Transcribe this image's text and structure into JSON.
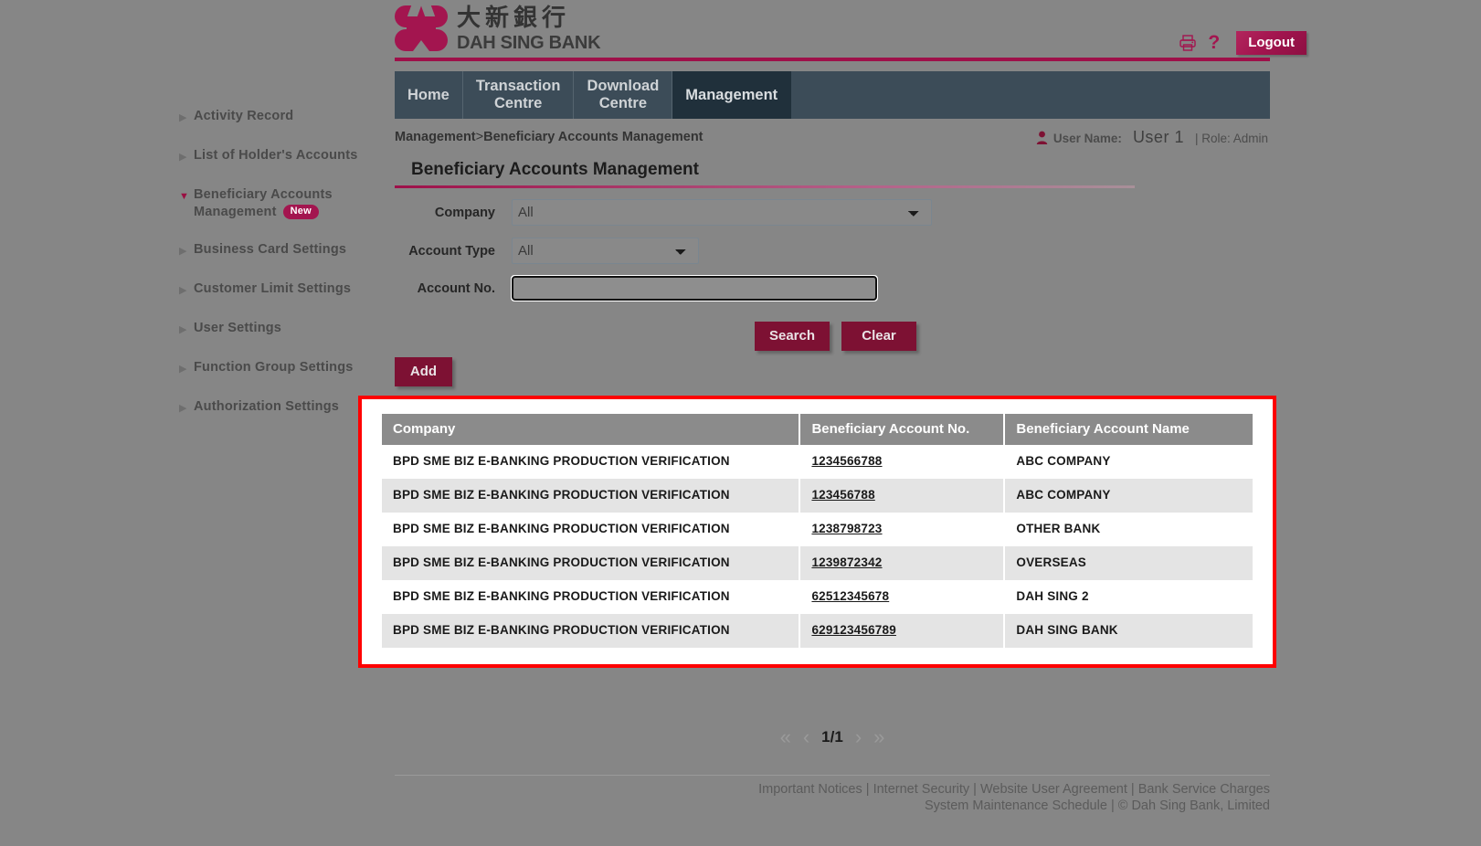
{
  "brand": {
    "name_cn": "大新銀行",
    "name_en": "DAH SING BANK",
    "logo_icon": "dah-sing-logo-icon"
  },
  "header": {
    "print_icon": "printer-icon",
    "help_icon": "question-mark-icon",
    "logout_label": "Logout"
  },
  "tabs": [
    {
      "label": "Home",
      "active": false
    },
    {
      "label": "Transaction\nCentre",
      "active": false
    },
    {
      "label": "Download\nCentre",
      "active": false
    },
    {
      "label": "Management",
      "active": true
    }
  ],
  "breadcrumb": {
    "parent": "Management",
    "separator": ">",
    "current": "Beneficiary Accounts Management"
  },
  "user": {
    "icon": "user-icon",
    "label": "User Name:",
    "name": "User 1",
    "role": "| Role: Admin"
  },
  "page_title": "Beneficiary Accounts Management",
  "sidebar": {
    "items": [
      {
        "label": "Activity Record",
        "expanded": false,
        "badge": null
      },
      {
        "label": "List of Holder's Accounts",
        "expanded": false,
        "badge": null
      },
      {
        "label": "Beneficiary Accounts Management",
        "expanded": true,
        "badge": "New"
      },
      {
        "label": "Business Card Settings",
        "expanded": false,
        "badge": null
      },
      {
        "label": "Customer Limit Settings",
        "expanded": false,
        "badge": null
      },
      {
        "label": "User Settings",
        "expanded": false,
        "badge": null
      },
      {
        "label": "Function Group Settings",
        "expanded": false,
        "badge": null
      },
      {
        "label": "Authorization Settings",
        "expanded": false,
        "badge": null
      }
    ]
  },
  "form": {
    "company": {
      "label": "Company",
      "value": "All",
      "options": [
        "All"
      ]
    },
    "account_type": {
      "label": "Account Type",
      "value": "All",
      "options": [
        "All"
      ]
    },
    "account_no": {
      "label": "Account No.",
      "value": "",
      "placeholder": ""
    }
  },
  "buttons": {
    "search": "Search",
    "clear": "Clear",
    "add": "Add"
  },
  "table": {
    "columns": [
      "Company",
      "Beneficiary Account No.",
      "Beneficiary Account Name"
    ],
    "rows": [
      {
        "company": "BPD SME BIZ E-BANKING PRODUCTION VERIFICATION",
        "account_no": "1234566788",
        "account_name": "ABC COMPANY"
      },
      {
        "company": "BPD SME BIZ E-BANKING PRODUCTION VERIFICATION",
        "account_no": "123456788",
        "account_name": "ABC COMPANY"
      },
      {
        "company": "BPD SME BIZ E-BANKING PRODUCTION VERIFICATION",
        "account_no": "1238798723",
        "account_name": "OTHER BANK"
      },
      {
        "company": "BPD SME BIZ E-BANKING PRODUCTION VERIFICATION",
        "account_no": "1239872342",
        "account_name": "OVERSEAS"
      },
      {
        "company": "BPD SME BIZ E-BANKING PRODUCTION VERIFICATION",
        "account_no": "62512345678",
        "account_name": "DAH SING 2"
      },
      {
        "company": "BPD SME BIZ E-BANKING PRODUCTION VERIFICATION",
        "account_no": "629123456789",
        "account_name": "DAH SING BANK"
      }
    ]
  },
  "pagination": {
    "first": "«",
    "prev": "‹",
    "page": "1/1",
    "next": "›",
    "last": "»"
  },
  "footer": {
    "line1": [
      "Important Notices",
      "Internet Security",
      "Website User Agreement",
      "Bank Service Charges"
    ],
    "line2": [
      "System Maintenance Schedule",
      "© Dah Sing Bank, Limited"
    ],
    "separator": "|"
  },
  "colors": {
    "brand": "#a3154f",
    "nav": "#3c4c58",
    "nav_active": "#20303b",
    "highlight": "#ff0000",
    "button": "#7d1133"
  }
}
